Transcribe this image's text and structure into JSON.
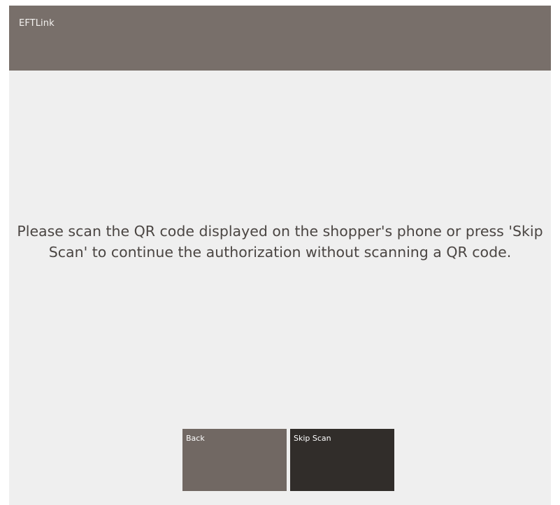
{
  "window": {
    "title": "EFTLink"
  },
  "main": {
    "message": "Please scan the QR code displayed on the shopper's phone or press 'Skip Scan' to continue the authorization without scanning a QR code."
  },
  "buttons": {
    "back_label": "Back",
    "skip_scan_label": "Skip Scan"
  },
  "colors": {
    "header_bg": "#786f6a",
    "content_bg": "#efefef",
    "back_button_bg": "#716863",
    "skip_button_bg": "#312d2a"
  }
}
